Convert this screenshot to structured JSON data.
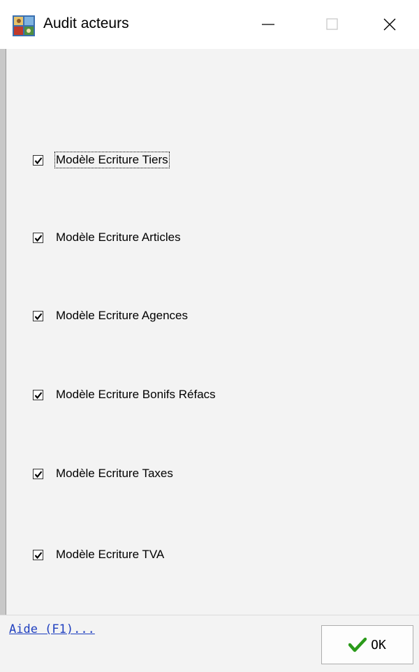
{
  "window": {
    "title": "Audit acteurs",
    "icon": "app-icon"
  },
  "titlebar_buttons": {
    "minimize_icon": "minimize-icon",
    "maximize_icon": "maximize-icon",
    "close_icon": "close-icon"
  },
  "checkboxes": [
    {
      "label": "Modèle Ecriture Tiers",
      "checked": true,
      "focused": true
    },
    {
      "label": "Modèle Ecriture Articles",
      "checked": true
    },
    {
      "label": "Modèle Ecriture Agences",
      "checked": true
    },
    {
      "label": "Modèle Ecriture Bonifs Réfacs",
      "checked": true
    },
    {
      "label": "Modèle Ecriture Taxes",
      "checked": true
    },
    {
      "label": "Modèle Ecriture TVA",
      "checked": true
    }
  ],
  "footer": {
    "help_link": "Aide (F1)...",
    "ok_label": "OK",
    "ok_icon": "checkmark-icon",
    "ok_icon_color": "#2a9a1a"
  }
}
